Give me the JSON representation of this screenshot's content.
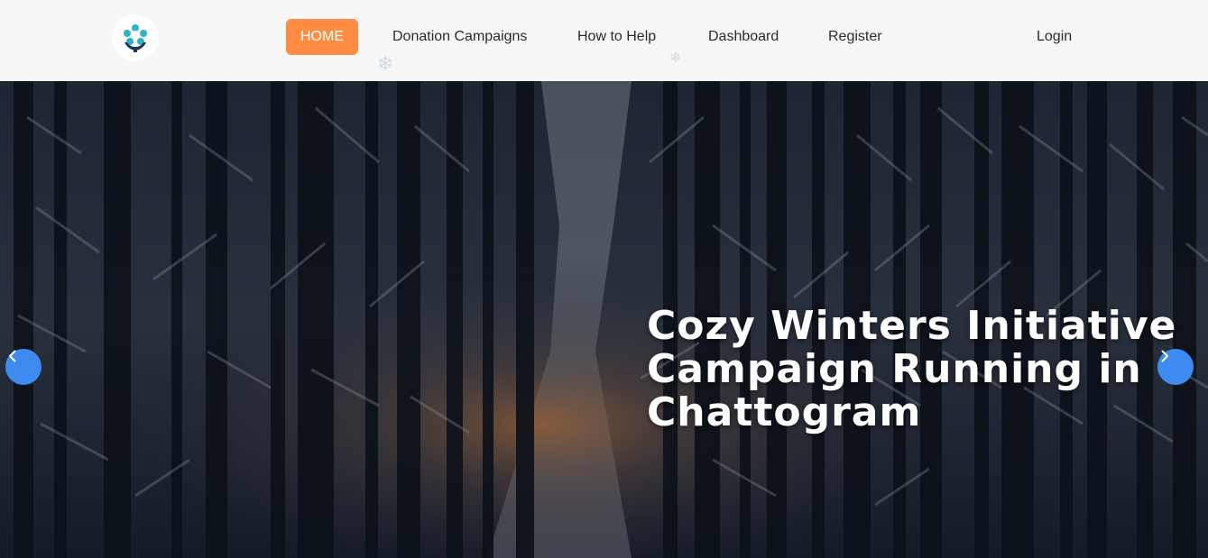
{
  "nav": {
    "home": "HOME",
    "donation_campaigns": "Donation Campaigns",
    "how_to_help": "How to Help",
    "dashboard": "Dashboard",
    "register": "Register",
    "login": "Login"
  },
  "icons": {
    "logo": "helping-hands-flower-logo",
    "prev": "chevron-left-icon",
    "next": "chevron-right-icon"
  },
  "hero": {
    "title_lines": [
      "Cozy Winters Initiative",
      "Campaign Running in",
      "Chattogram"
    ]
  },
  "colors": {
    "accent": "#ff8c42",
    "carousel_button": "#3d8bf0",
    "navbar_bg": "#f7f7f7",
    "logo_teal": "#2bb3c8",
    "logo_navy": "#1d3557"
  }
}
